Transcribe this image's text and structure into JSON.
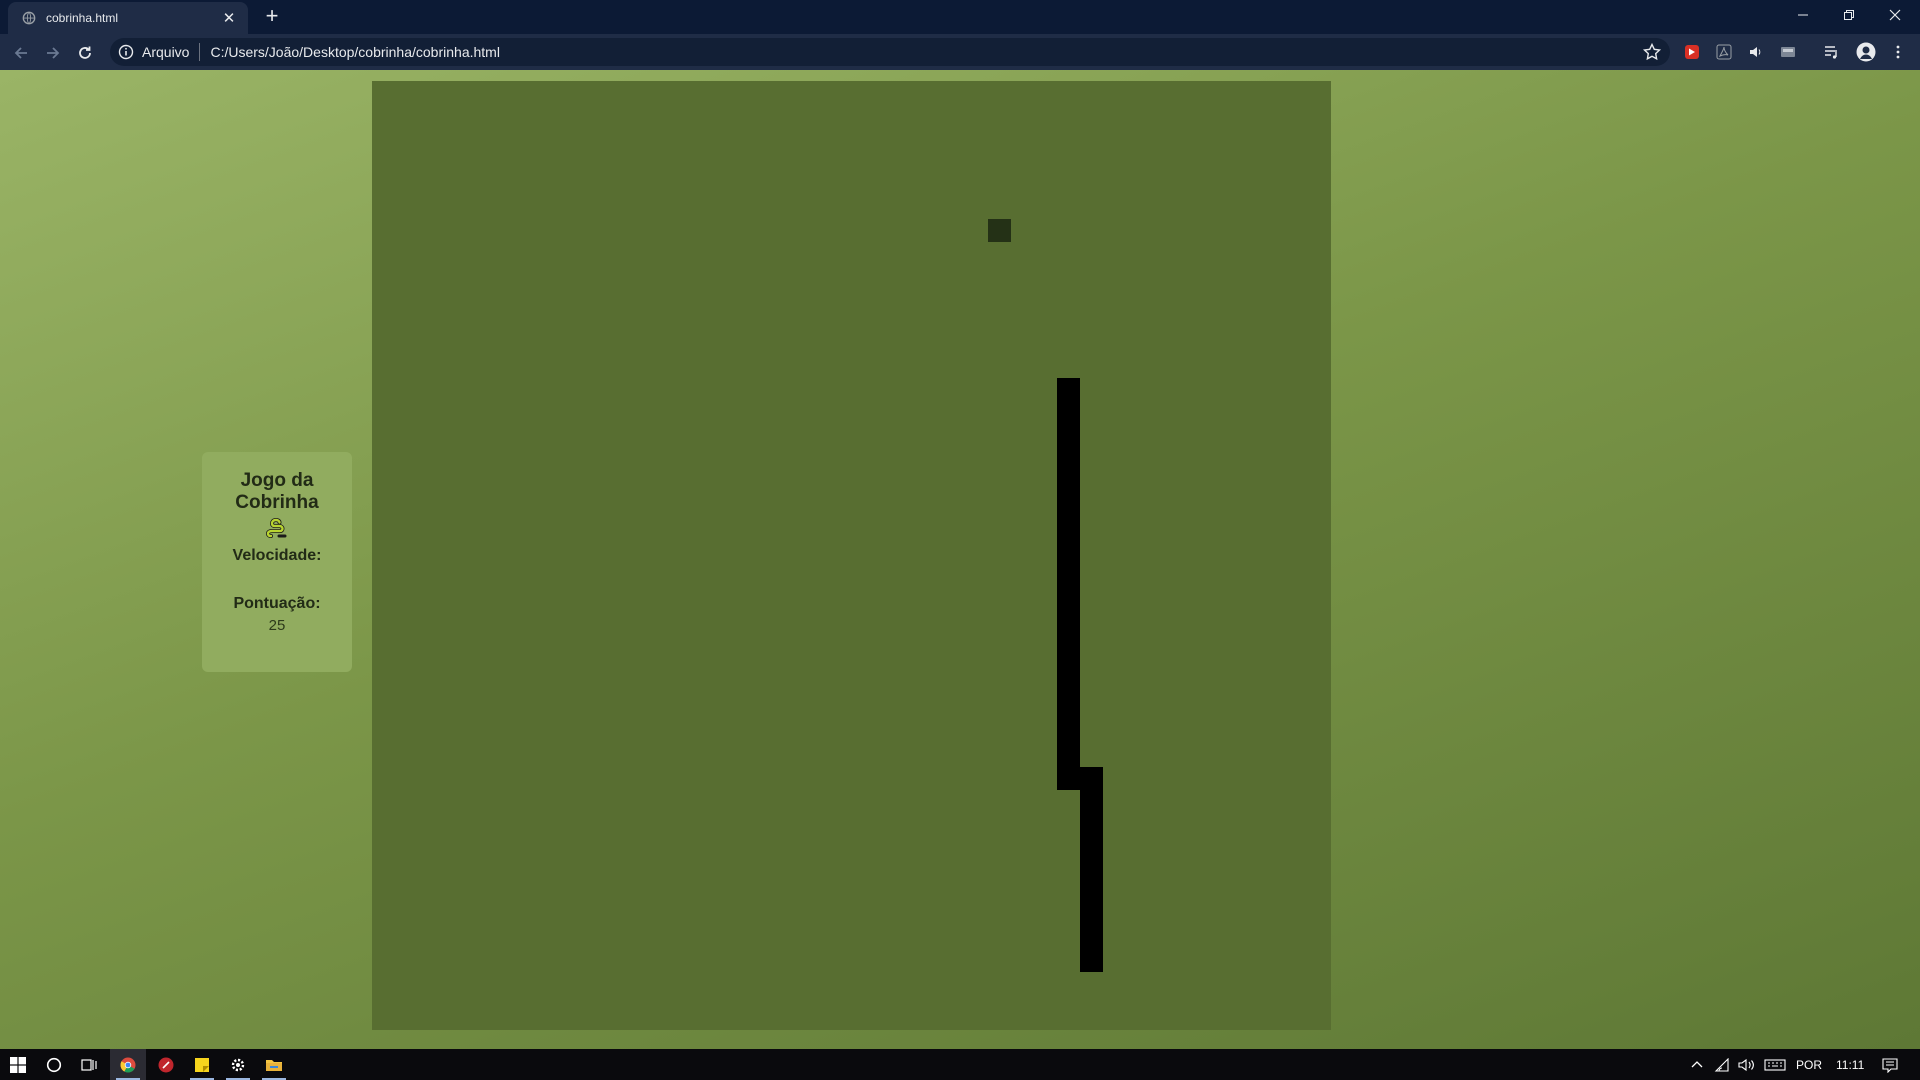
{
  "browser": {
    "tab_title": "cobrinha.html",
    "tab_close": "✕",
    "new_tab": "+",
    "address_label": "Arquivo",
    "url": "C:/Users/João/Desktop/cobrinha/cobrinha.html"
  },
  "game": {
    "title_line1": "Jogo da",
    "title_line2": "Cobrinha",
    "speed_label": "Velocidade:",
    "speed_value": "",
    "score_label": "Pontuação:",
    "score_value": "25",
    "colors": {
      "background": "#586e31",
      "snake": "#000000",
      "food": "#243116",
      "panel": "#91ac5f"
    }
  },
  "taskbar": {
    "language": "POR",
    "time": "11:11"
  }
}
